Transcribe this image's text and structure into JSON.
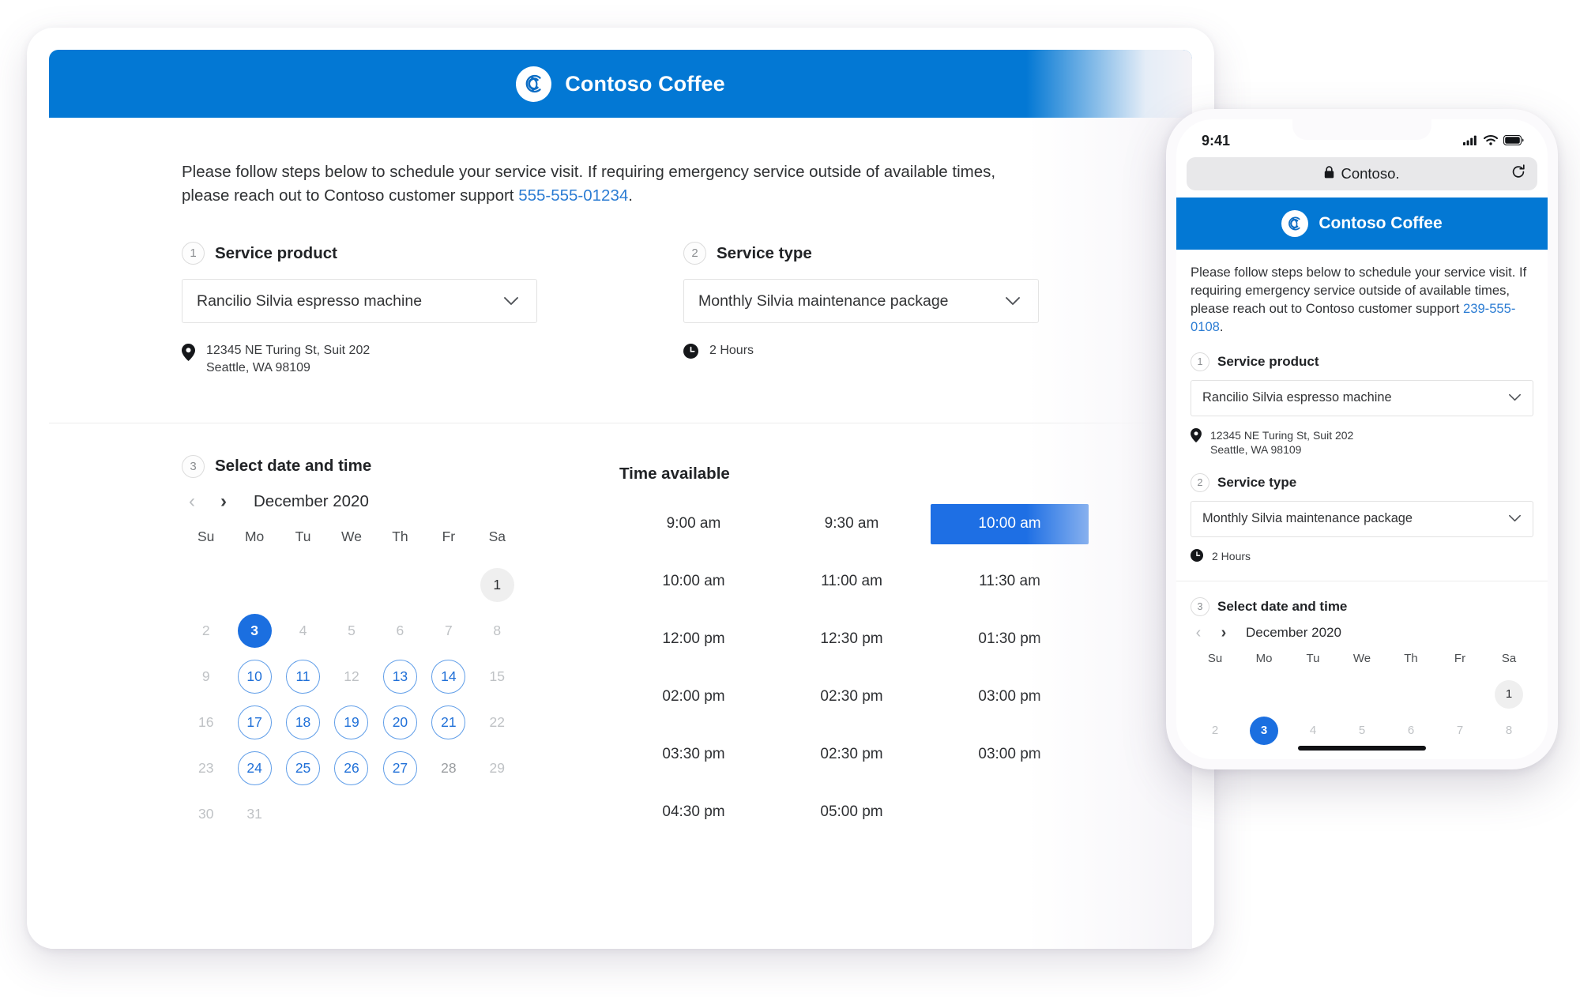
{
  "brand": {
    "name": "Contoso Coffee",
    "logo_icon": "contoso-c-logo",
    "header_color": "#0378d4"
  },
  "desktop": {
    "intro": {
      "text_before": "Please follow steps below to schedule your service visit. If requiring emergency service outside of available times, please reach out to Contoso customer support ",
      "phone": "555-555-01234",
      "text_after": "."
    },
    "step1": {
      "number": "1",
      "label": "Service product",
      "selected_value": "Rancilio Silvia espresso machine",
      "chevron_icon": "chevron-down-icon",
      "location_icon": "map-pin-icon",
      "address_line1": "12345 NE Turing St, Suit 202",
      "address_line2": "Seattle, WA 98109"
    },
    "step2": {
      "number": "2",
      "label": "Service type",
      "selected_value": "Monthly Silvia maintenance package",
      "chevron_icon": "chevron-down-icon",
      "clock_icon": "clock-icon",
      "duration": "2 Hours"
    },
    "step3": {
      "number": "3",
      "label": "Select date and time",
      "prev_icon": "chevron-left-icon",
      "next_icon": "chevron-right-icon",
      "month_title": "December 2020",
      "day_headers": [
        "Su",
        "Mo",
        "Tu",
        "We",
        "Th",
        "Fr",
        "Sa"
      ],
      "days": [
        {
          "label": "",
          "state": "blank"
        },
        {
          "label": "",
          "state": "blank"
        },
        {
          "label": "",
          "state": "blank"
        },
        {
          "label": "",
          "state": "blank"
        },
        {
          "label": "",
          "state": "blank"
        },
        {
          "label": "",
          "state": "blank"
        },
        {
          "label": "1",
          "state": "today"
        },
        {
          "label": "2",
          "state": "disabled"
        },
        {
          "label": "3",
          "state": "selected"
        },
        {
          "label": "4",
          "state": "disabled"
        },
        {
          "label": "5",
          "state": "disabled"
        },
        {
          "label": "6",
          "state": "disabled"
        },
        {
          "label": "7",
          "state": "disabled"
        },
        {
          "label": "8",
          "state": "disabled"
        },
        {
          "label": "9",
          "state": "disabled"
        },
        {
          "label": "10",
          "state": "available"
        },
        {
          "label": "11",
          "state": "available"
        },
        {
          "label": "12",
          "state": "disabled"
        },
        {
          "label": "13",
          "state": "available"
        },
        {
          "label": "14",
          "state": "available"
        },
        {
          "label": "15",
          "state": "disabled"
        },
        {
          "label": "16",
          "state": "disabled"
        },
        {
          "label": "17",
          "state": "available"
        },
        {
          "label": "18",
          "state": "available"
        },
        {
          "label": "19",
          "state": "available"
        },
        {
          "label": "20",
          "state": "available"
        },
        {
          "label": "21",
          "state": "available"
        },
        {
          "label": "22",
          "state": "disabled"
        },
        {
          "label": "23",
          "state": "disabled"
        },
        {
          "label": "24",
          "state": "available"
        },
        {
          "label": "25",
          "state": "available"
        },
        {
          "label": "26",
          "state": "available"
        },
        {
          "label": "27",
          "state": "available"
        },
        {
          "label": "28",
          "state": "dim"
        },
        {
          "label": "29",
          "state": "disabled"
        },
        {
          "label": "30",
          "state": "disabled"
        },
        {
          "label": "31",
          "state": "disabled"
        },
        {
          "label": "",
          "state": "blank"
        },
        {
          "label": "",
          "state": "blank"
        },
        {
          "label": "",
          "state": "blank"
        },
        {
          "label": "",
          "state": "blank"
        },
        {
          "label": "",
          "state": "blank"
        }
      ]
    },
    "time_section": {
      "title": "Time available",
      "slots": [
        {
          "label": "9:00 am",
          "state": "normal"
        },
        {
          "label": "9:30 am",
          "state": "normal"
        },
        {
          "label": "10:00 am",
          "state": "selected"
        },
        {
          "label": "10:00 am",
          "state": "normal"
        },
        {
          "label": "11:00 am",
          "state": "normal"
        },
        {
          "label": "11:30 am",
          "state": "normal"
        },
        {
          "label": "12:00 pm",
          "state": "normal"
        },
        {
          "label": "12:30 pm",
          "state": "normal"
        },
        {
          "label": "01:30 pm",
          "state": "normal"
        },
        {
          "label": "02:00 pm",
          "state": "normal"
        },
        {
          "label": "02:30 pm",
          "state": "normal"
        },
        {
          "label": "03:00 pm",
          "state": "normal"
        },
        {
          "label": "03:30 pm",
          "state": "normal"
        },
        {
          "label": "02:30 pm",
          "state": "normal"
        },
        {
          "label": "03:00 pm",
          "state": "normal"
        },
        {
          "label": "04:30 pm",
          "state": "normal"
        },
        {
          "label": "05:00 pm",
          "state": "normal"
        },
        {
          "label": "",
          "state": "empty"
        }
      ]
    }
  },
  "phone": {
    "status": {
      "time": "9:41",
      "signal_icon": "cellular-signal-icon",
      "wifi_icon": "wifi-icon",
      "battery_icon": "battery-full-icon"
    },
    "browser": {
      "lock_icon": "lock-icon",
      "url": "Contoso.",
      "reload_icon": "reload-icon"
    },
    "intro": {
      "text_before": "Please follow steps below to schedule your service visit. If requiring emergency service outside of available times, please reach out to Contoso customer support ",
      "phone": "239-555-0108",
      "text_after": "."
    },
    "step1": {
      "number": "1",
      "label": "Service product",
      "selected_value": "Rancilio Silvia espresso machine",
      "chevron_icon": "chevron-down-icon",
      "location_icon": "map-pin-icon",
      "address_line1": "12345 NE Turing St, Suit 202",
      "address_line2": "Seattle, WA 98109"
    },
    "step2": {
      "number": "2",
      "label": "Service type",
      "selected_value": "Monthly Silvia maintenance package",
      "chevron_icon": "chevron-down-icon",
      "clock_icon": "clock-icon",
      "duration": "2 Hours"
    },
    "step3": {
      "number": "3",
      "label": "Select date and time",
      "prev_icon": "chevron-left-icon",
      "next_icon": "chevron-right-icon",
      "month_title": "December 2020",
      "day_headers": [
        "Su",
        "Mo",
        "Tu",
        "We",
        "Th",
        "Fr",
        "Sa"
      ],
      "days": [
        {
          "label": "",
          "state": "blank"
        },
        {
          "label": "",
          "state": "blank"
        },
        {
          "label": "",
          "state": "blank"
        },
        {
          "label": "",
          "state": "blank"
        },
        {
          "label": "",
          "state": "blank"
        },
        {
          "label": "",
          "state": "blank"
        },
        {
          "label": "1",
          "state": "today"
        },
        {
          "label": "2",
          "state": "disabled"
        },
        {
          "label": "3",
          "state": "selected"
        },
        {
          "label": "4",
          "state": "disabled"
        },
        {
          "label": "5",
          "state": "disabled"
        },
        {
          "label": "6",
          "state": "disabled"
        },
        {
          "label": "7",
          "state": "disabled"
        },
        {
          "label": "8",
          "state": "disabled"
        }
      ]
    }
  }
}
